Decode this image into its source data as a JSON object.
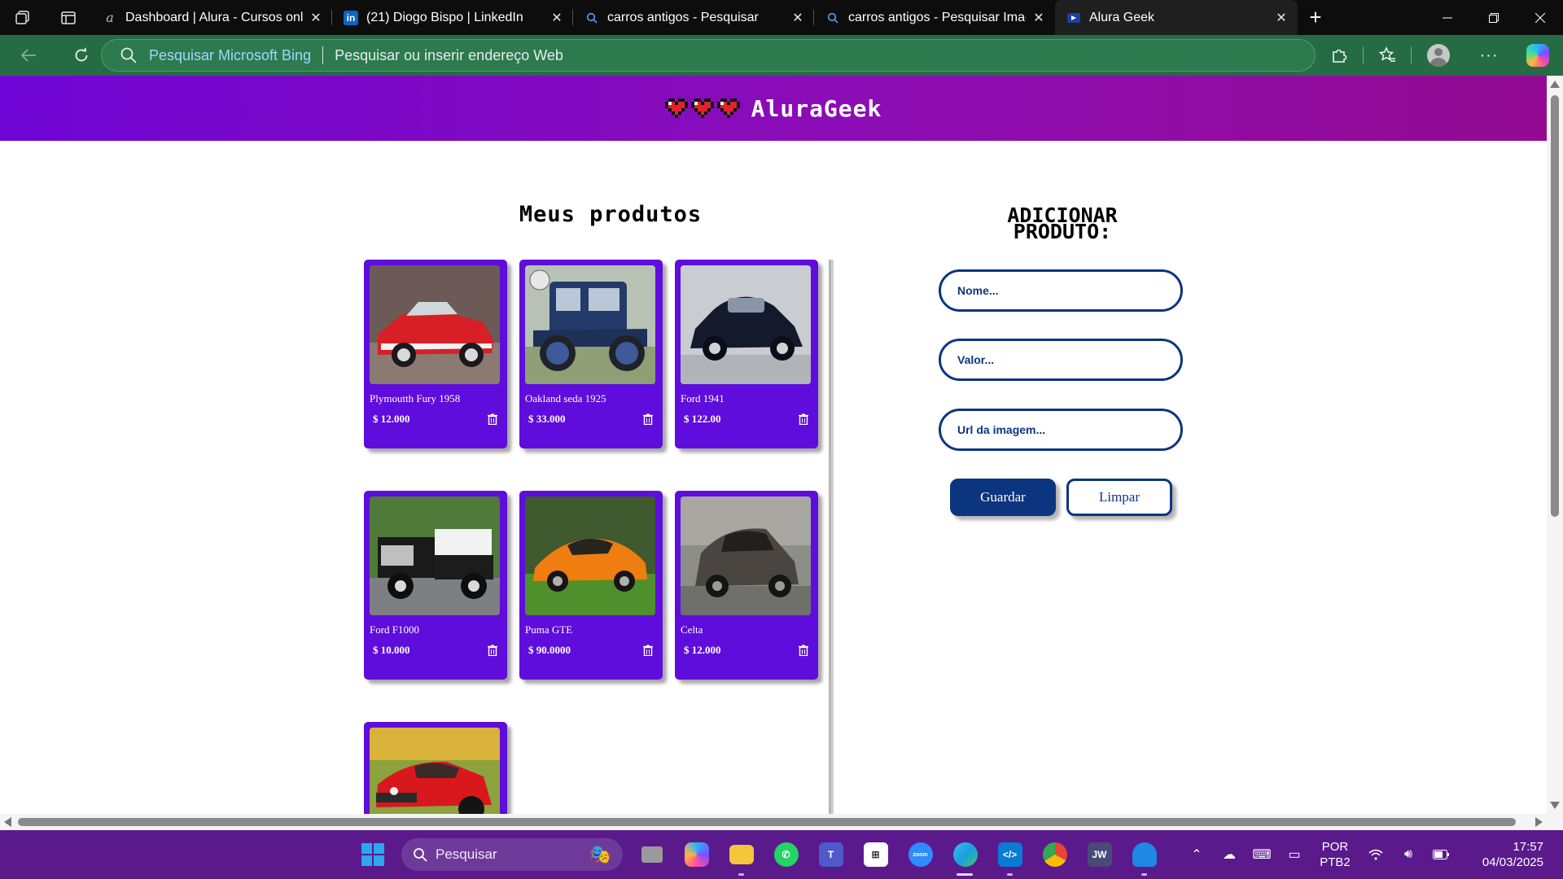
{
  "browser": {
    "tabs": [
      {
        "title": "Dashboard | Alura - Cursos online",
        "icon": "alura-favicon"
      },
      {
        "title": "(21) Diogo Bispo | LinkedIn",
        "icon": "linkedin-favicon"
      },
      {
        "title": "carros antigos - Pesquisar",
        "icon": "bing-search-favicon"
      },
      {
        "title": "carros antigos - Pesquisar Imagens",
        "icon": "bing-search-favicon"
      },
      {
        "title": "Alura Geek",
        "icon": "alura-geek-favicon",
        "active": true
      }
    ],
    "address_bar": {
      "engine_label": "Pesquisar Microsoft Bing",
      "placeholder": "Pesquisar ou inserir endereço Web"
    },
    "colors": {
      "tabstrip": "#0d0d0d",
      "toolbar": "#256c45"
    }
  },
  "site": {
    "brand_name": "AluraGeek",
    "header_gradient": [
      "#6f05d6",
      "#930b91"
    ],
    "products_title": "Meus produtos",
    "products": [
      {
        "name": "Plymoutth Fury 1958",
        "price": "$ 12.000",
        "image": "red-white-vintage-car"
      },
      {
        "name": "Oakland seda 1925",
        "price": "$ 33.000",
        "image": "blue-antique-sedan"
      },
      {
        "name": "Ford 1941",
        "price": "$ 122.00",
        "image": "black-1940s-coupe"
      },
      {
        "name": "Ford F1000",
        "price": "$ 10.000",
        "image": "black-white-pickup-truck"
      },
      {
        "name": "Puma GTE",
        "price": "$ 90.0000",
        "image": "orange-sports-car"
      },
      {
        "name": "Celta",
        "price": "$ 12.000",
        "image": "grey-hatchback"
      },
      {
        "name": "",
        "price": "",
        "image": "red-vintage-coupe"
      }
    ],
    "form": {
      "title_line1": "ADICIONAR",
      "title_line2": "PRODUTO:",
      "name_placeholder": "Nome...",
      "value_placeholder": "Valor...",
      "url_placeholder": "Url da imagem...",
      "save_label": "Guardar",
      "clear_label": "Limpar"
    },
    "colors": {
      "card": "#5f0ddc",
      "accent": "#0c3580"
    }
  },
  "taskbar": {
    "search_label": "Pesquisar",
    "language": "POR",
    "keyboard": "PTB2",
    "time": "17:57",
    "date": "04/03/2025"
  }
}
